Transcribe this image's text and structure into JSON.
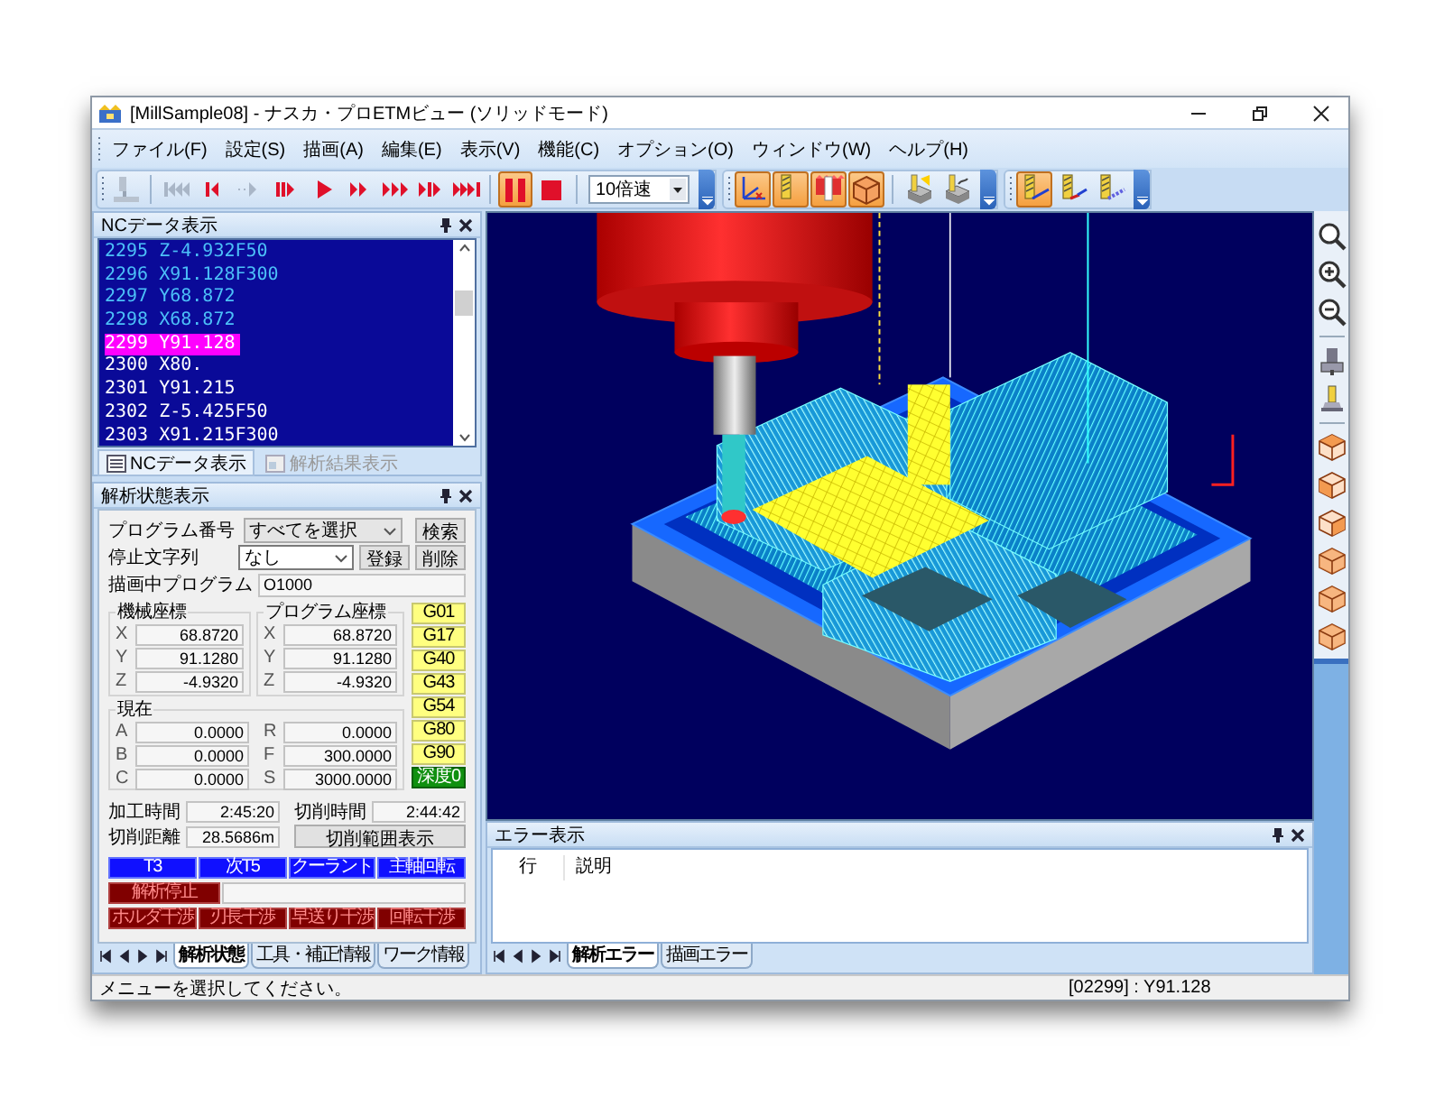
{
  "window": {
    "title": "[MillSample08] - ナスカ・プロETMビュー (ソリッドモード)"
  },
  "menu": [
    "ファイル(F)",
    "設定(S)",
    "描画(A)",
    "編集(E)",
    "表示(V)",
    "機能(C)",
    "オプション(O)",
    "ウィンドウ(W)",
    "ヘルプ(H)"
  ],
  "toolbar": {
    "playback": [
      {
        "kind": "machine",
        "disabled": true
      },
      {
        "kind": "first",
        "disabled": true
      },
      {
        "kind": "prev",
        "disabled": false
      },
      {
        "kind": "back",
        "disabled": true
      },
      {
        "kind": "step",
        "disabled": false
      },
      {
        "kind": "play",
        "disabled": false
      },
      {
        "kind": "fast",
        "disabled": false
      },
      {
        "kind": "faster",
        "disabled": false
      },
      {
        "kind": "skip",
        "disabled": false
      },
      {
        "kind": "last",
        "disabled": false
      }
    ],
    "transport": [
      {
        "kind": "pause",
        "selected": true
      },
      {
        "kind": "stop",
        "selected": false
      }
    ],
    "speed": "10倍速",
    "display": [
      {
        "kind": "axes",
        "selected": true
      },
      {
        "kind": "tool",
        "selected": true
      },
      {
        "kind": "holder",
        "selected": true
      },
      {
        "kind": "cube",
        "selected": true
      },
      {
        "kind": "work-light",
        "selected": false
      },
      {
        "kind": "work-tool",
        "selected": false
      }
    ],
    "path_display": [
      {
        "kind": "path",
        "selected": true
      },
      {
        "kind": "path-rapid",
        "selected": false
      },
      {
        "kind": "path-dots",
        "selected": false
      }
    ]
  },
  "nc_panel": {
    "title": "NCデータ表示",
    "rows": [
      {
        "line": "2295",
        "code": "Z-4.932F50",
        "executed": true,
        "selected": false
      },
      {
        "line": "2296",
        "code": "X91.128F300",
        "executed": true,
        "selected": false
      },
      {
        "line": "2297",
        "code": "Y68.872",
        "executed": true,
        "selected": false
      },
      {
        "line": "2298",
        "code": "X68.872",
        "executed": true,
        "selected": false
      },
      {
        "line": "2299",
        "code": "Y91.128",
        "executed": false,
        "selected": true
      },
      {
        "line": "2300",
        "code": "X80.",
        "executed": false,
        "selected": false
      },
      {
        "line": "2301",
        "code": "Y91.215",
        "executed": false,
        "selected": false
      },
      {
        "line": "2302",
        "code": "Z-5.425F50",
        "executed": false,
        "selected": false
      },
      {
        "line": "2303",
        "code": "X91.215F300",
        "executed": false,
        "selected": false
      }
    ],
    "tabs": [
      {
        "label": "NCデータ表示",
        "selected": true
      },
      {
        "label": "解析結果表示",
        "selected": false
      }
    ]
  },
  "analysis_panel": {
    "title": "解析状態表示",
    "program_number": {
      "label": "プログラム番号",
      "value": "すべてを選択",
      "button": "検索"
    },
    "stop_string": {
      "label": "停止文字列",
      "value": "なし",
      "buttons": [
        "登録",
        "削除"
      ]
    },
    "current_program": {
      "label": "描画中プログラム",
      "value": "O1000"
    },
    "machine_coords": {
      "title": "機械座標",
      "rows": [
        {
          "axis": "X",
          "value": "68.8720"
        },
        {
          "axis": "Y",
          "value": "91.1280"
        },
        {
          "axis": "Z",
          "value": "-4.9320"
        }
      ]
    },
    "program_coords": {
      "title": "プログラム座標",
      "rows": [
        {
          "axis": "X",
          "value": "68.8720"
        },
        {
          "axis": "Y",
          "value": "91.1280"
        },
        {
          "axis": "Z",
          "value": "-4.9320"
        }
      ]
    },
    "current": {
      "title": "現在",
      "rows": [
        {
          "axis": "A",
          "value": "0.0000"
        },
        {
          "axis": "B",
          "value": "0.0000"
        },
        {
          "axis": "C",
          "value": "0.0000"
        },
        {
          "axis": "R",
          "value": "0.0000"
        },
        {
          "axis": "F",
          "value": "300.0000"
        },
        {
          "axis": "S",
          "value": "3000.0000"
        }
      ]
    },
    "modal_codes": [
      {
        "label": "G01",
        "kind": "code"
      },
      {
        "label": "G17",
        "kind": "code"
      },
      {
        "label": "G40",
        "kind": "code"
      },
      {
        "label": "G43",
        "kind": "code"
      },
      {
        "label": "G54",
        "kind": "code"
      },
      {
        "label": "G80",
        "kind": "code"
      },
      {
        "label": "G90",
        "kind": "code"
      },
      {
        "label": "深度0",
        "kind": "depth"
      }
    ],
    "times": [
      {
        "label": "加工時間",
        "value": "2:45:20"
      },
      {
        "label": "切削時間",
        "value": "2:44:42"
      }
    ],
    "cut_distance": {
      "label": "切削距離",
      "value": "28.5686m"
    },
    "range_button": "切削範囲表示",
    "lamps": [
      {
        "label": "T3",
        "on": true
      },
      {
        "label": "次T5",
        "on": true
      },
      {
        "label": "クーラント",
        "on": true
      },
      {
        "label": "主軸回転",
        "on": true
      }
    ],
    "stop_lamp": {
      "label": "解析停止",
      "on": false
    },
    "interference_lamps": [
      {
        "label": "ホルダ干渉",
        "on": false
      },
      {
        "label": "刃長干渉",
        "on": false
      },
      {
        "label": "早送り干渉",
        "on": false
      },
      {
        "label": "回転干渉",
        "on": false
      }
    ],
    "tabs": [
      {
        "label": "解析状態",
        "selected": true
      },
      {
        "label": "工具・補正情報",
        "selected": false
      },
      {
        "label": "ワーク情報",
        "selected": false
      }
    ]
  },
  "error_panel": {
    "title": "エラー表示",
    "columns": [
      "行",
      "説明"
    ],
    "tabs": [
      {
        "label": "解析エラー",
        "selected": true
      },
      {
        "label": "描画エラー",
        "selected": false
      }
    ]
  },
  "status_bar": {
    "message": "メニューを選択してください。",
    "position": "[02299] : Y91.128"
  }
}
